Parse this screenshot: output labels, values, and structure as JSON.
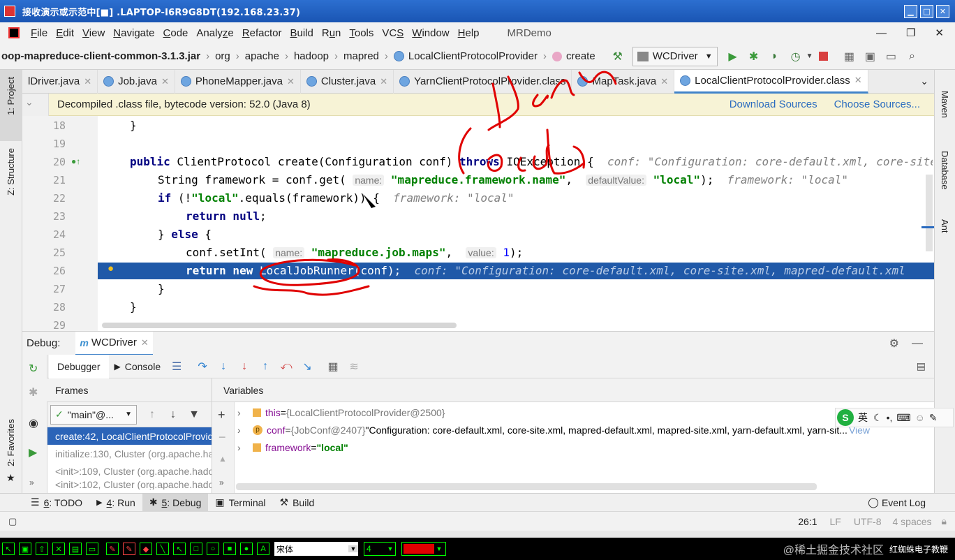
{
  "remote_title": "接收演示或示范中[■] .LAPTOP-I6R9G8DT(192.168.23.37)",
  "menu": {
    "items": [
      {
        "pre": "",
        "u": "F",
        "post": "ile"
      },
      {
        "pre": "",
        "u": "E",
        "post": "dit"
      },
      {
        "pre": "",
        "u": "V",
        "post": "iew"
      },
      {
        "pre": "",
        "u": "N",
        "post": "avigate"
      },
      {
        "pre": "",
        "u": "C",
        "post": "ode"
      },
      {
        "pre": "Analy",
        "u": "z",
        "post": "e"
      },
      {
        "pre": "",
        "u": "R",
        "post": "efactor"
      },
      {
        "pre": "",
        "u": "B",
        "post": "uild"
      },
      {
        "pre": "R",
        "u": "u",
        "post": "n"
      },
      {
        "pre": "",
        "u": "T",
        "post": "ools"
      },
      {
        "pre": "VC",
        "u": "S",
        "post": ""
      },
      {
        "pre": "",
        "u": "W",
        "post": "indow"
      },
      {
        "pre": "",
        "u": "H",
        "post": "elp"
      }
    ],
    "project": "MRDemo"
  },
  "nav": {
    "crumbs": [
      "oop-mapreduce-client-common-3.1.3.jar",
      "org",
      "apache",
      "hadoop",
      "mapred",
      "LocalClientProtocolProvider",
      "create"
    ],
    "run_config": "WCDriver"
  },
  "tabs": [
    {
      "label": "lDriver.java",
      "active": false
    },
    {
      "label": "Job.java",
      "active": false
    },
    {
      "label": "PhoneMapper.java",
      "active": false
    },
    {
      "label": "Cluster.java",
      "active": false
    },
    {
      "label": "YarnClientProtocolProvider.class",
      "active": false
    },
    {
      "label": "MapTask.java",
      "active": false
    },
    {
      "label": "LocalClientProtocolProvider.class",
      "active": true
    }
  ],
  "notice": {
    "text": "Decompiled .class file, bytecode version: 52.0 (Java 8)",
    "download": "Download Sources",
    "choose": "Choose Sources..."
  },
  "side": {
    "project": "1: Project",
    "structure": "Z: Structure",
    "favorites": "2: Favorites",
    "maven": "Maven",
    "database": "Database",
    "ant": "Ant"
  },
  "code": {
    "line_numbers": [
      "18",
      "19",
      "20",
      "21",
      "22",
      "23",
      "24",
      "25",
      "26",
      "27",
      "28",
      "29"
    ]
  },
  "debug": {
    "label": "Debug:",
    "config": "WCDriver",
    "debugger_tab": "Debugger",
    "console_tab": "Console",
    "frames_title": "Frames",
    "variables_title": "Variables",
    "thread": "\"main\"@...",
    "frames": [
      "create:42, LocalClientProtocolProvider",
      "initialize:130, Cluster (org.apache.hado",
      "<init>:109, Cluster (org.apache.hadoop",
      "<init>:102, Cluster (org.apache.hadoop"
    ],
    "vars": [
      {
        "name": "this",
        "eq": " = ",
        "val": "{LocalClientProtocolProvider@2500}",
        "extra": ""
      },
      {
        "name": "conf",
        "eq": " = ",
        "val": "{JobConf@2407}",
        "extra": " \"Configuration: core-default.xml, core-site.xml, mapred-default.xml, mapred-site.xml, yarn-default.xml, yarn-sit..."
      },
      {
        "name": "framework",
        "eq": " = ",
        "val": "\"local\"",
        "extra": ""
      }
    ],
    "view_link": "View"
  },
  "bottom_tabs": [
    {
      "num": "6",
      "label": ": TODO"
    },
    {
      "num": "4",
      "label": ": Run"
    },
    {
      "num": "5",
      "label": ": Debug"
    },
    {
      "num": "",
      "label": "Terminal"
    },
    {
      "num": "",
      "label": "Build"
    }
  ],
  "event_log": "Event Log",
  "status": {
    "pos": "26:1",
    "lf": "LF",
    "enc": "UTF-8",
    "indent": "4 spaces"
  },
  "ime": {
    "lang": "英"
  },
  "drawbar": {
    "font": "宋体",
    "size": "4",
    "watermark": "@稀土掘金技术社区",
    "brand": "红蜘蛛电子教鞭"
  },
  "annotations": {
    "text1": "Yarn",
    "text2": "Local"
  },
  "colors": {
    "accent": "#2059a8",
    "title_bar": "#1a55b3",
    "drawing_ink": "#e00000"
  }
}
